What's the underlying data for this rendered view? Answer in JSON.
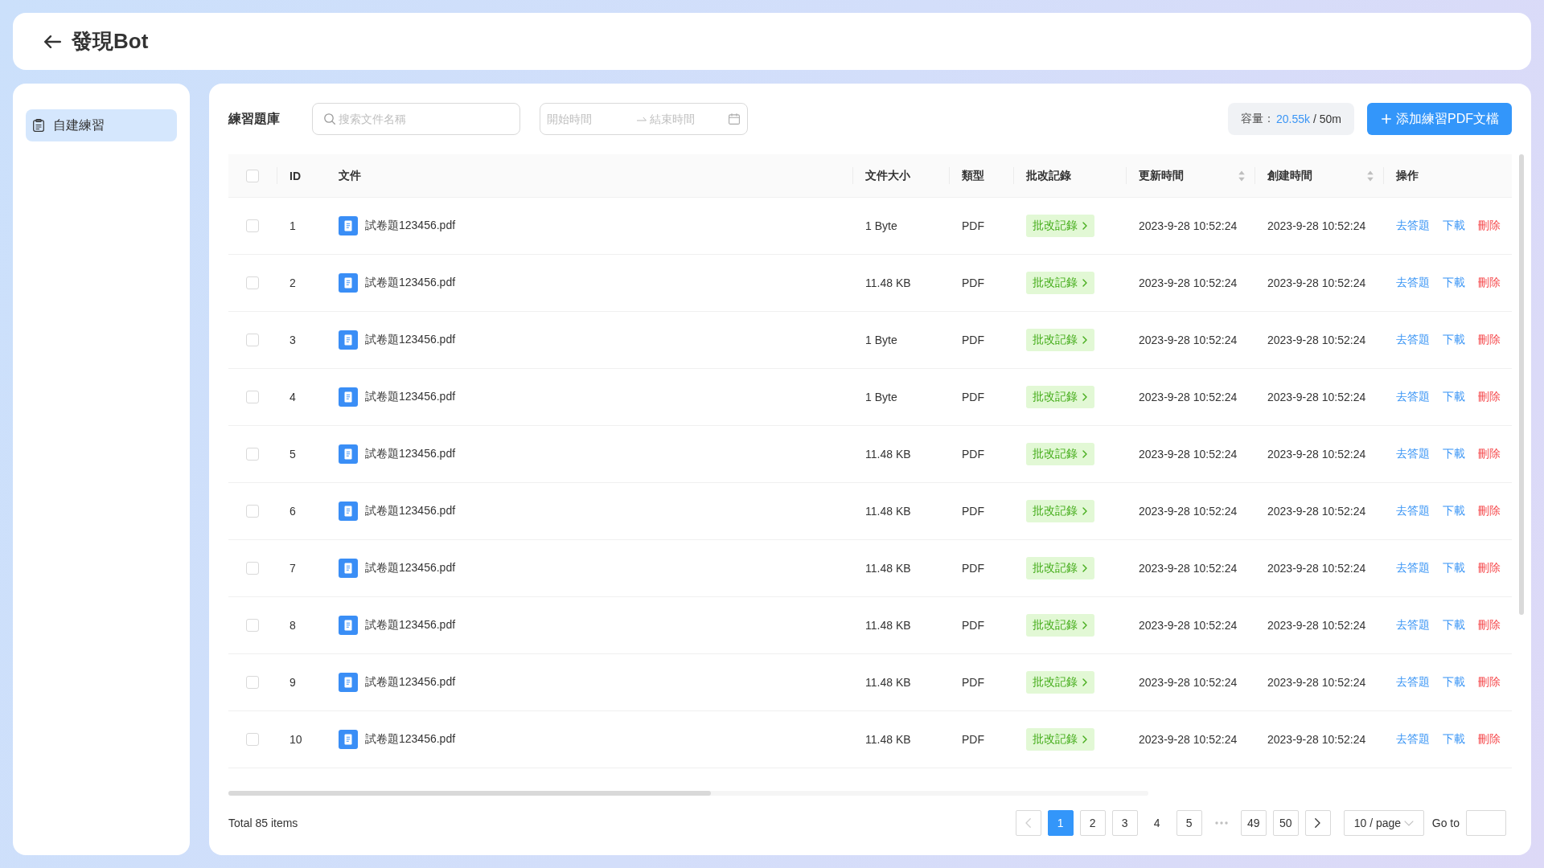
{
  "header": {
    "title": "發現Bot"
  },
  "sidebar": {
    "items": [
      {
        "label": "自建練習",
        "selected": true
      }
    ]
  },
  "toolbar": {
    "title": "練習題庫",
    "search": {
      "placeholder": "搜索文件名稱"
    },
    "date_range": {
      "start_placeholder": "開始時間",
      "end_placeholder": "結束時間"
    },
    "capacity": {
      "label": "容量：",
      "used": "20.55k",
      "total": "/ 50m"
    },
    "add_button": {
      "label": "添加練習PDF文檔"
    }
  },
  "table": {
    "select_all_checked": false,
    "columns": [
      {
        "label": "ID",
        "sortable": false
      },
      {
        "label": "文件",
        "sortable": false
      },
      {
        "label": "文件大小",
        "sortable": false
      },
      {
        "label": "類型",
        "sortable": false
      },
      {
        "label": "批改記錄",
        "sortable": false
      },
      {
        "label": "更新時間",
        "sortable": true
      },
      {
        "label": "創建時間",
        "sortable": true
      },
      {
        "label": "操作",
        "sortable": false
      }
    ],
    "rows": [
      {
        "checked": false,
        "id": "1",
        "file": "試卷題123456.pdf",
        "size": "1 Byte",
        "type": "PDF",
        "review": "批改記錄",
        "updated": "2023-9-28 10:52:24",
        "created": "2023-9-28 10:52:24",
        "actions": [
          {
            "label": "去答題",
            "kind": "primary"
          },
          {
            "label": "下載",
            "kind": "primary"
          },
          {
            "label": "刪除",
            "kind": "danger"
          }
        ]
      },
      {
        "checked": false,
        "id": "2",
        "file": "試卷題123456.pdf",
        "size": "11.48 KB",
        "type": "PDF",
        "review": "批改記錄",
        "updated": "2023-9-28 10:52:24",
        "created": "2023-9-28 10:52:24",
        "actions": [
          {
            "label": "去答題",
            "kind": "primary"
          },
          {
            "label": "下載",
            "kind": "primary"
          },
          {
            "label": "刪除",
            "kind": "danger"
          }
        ]
      },
      {
        "checked": false,
        "id": "3",
        "file": "試卷題123456.pdf",
        "size": "1 Byte",
        "type": "PDF",
        "review": "批改記錄",
        "updated": "2023-9-28 10:52:24",
        "created": "2023-9-28 10:52:24",
        "actions": [
          {
            "label": "去答題",
            "kind": "primary"
          },
          {
            "label": "下載",
            "kind": "primary"
          },
          {
            "label": "刪除",
            "kind": "danger"
          }
        ]
      },
      {
        "checked": false,
        "id": "4",
        "file": "試卷題123456.pdf",
        "size": "1 Byte",
        "type": "PDF",
        "review": "批改記錄",
        "updated": "2023-9-28 10:52:24",
        "created": "2023-9-28 10:52:24",
        "actions": [
          {
            "label": "去答題",
            "kind": "primary"
          },
          {
            "label": "下載",
            "kind": "primary"
          },
          {
            "label": "刪除",
            "kind": "danger"
          }
        ]
      },
      {
        "checked": false,
        "id": "5",
        "file": "試卷題123456.pdf",
        "size": "11.48 KB",
        "type": "PDF",
        "review": "批改記錄",
        "updated": "2023-9-28 10:52:24",
        "created": "2023-9-28 10:52:24",
        "actions": [
          {
            "label": "去答題",
            "kind": "primary"
          },
          {
            "label": "下載",
            "kind": "primary"
          },
          {
            "label": "刪除",
            "kind": "danger"
          }
        ]
      },
      {
        "checked": false,
        "id": "6",
        "file": "試卷題123456.pdf",
        "size": "11.48 KB",
        "type": "PDF",
        "review": "批改記錄",
        "updated": "2023-9-28 10:52:24",
        "created": "2023-9-28 10:52:24",
        "actions": [
          {
            "label": "去答題",
            "kind": "primary"
          },
          {
            "label": "下載",
            "kind": "primary"
          },
          {
            "label": "刪除",
            "kind": "danger"
          }
        ]
      },
      {
        "checked": false,
        "id": "7",
        "file": "試卷題123456.pdf",
        "size": "11.48 KB",
        "type": "PDF",
        "review": "批改記錄",
        "updated": "2023-9-28 10:52:24",
        "created": "2023-9-28 10:52:24",
        "actions": [
          {
            "label": "去答題",
            "kind": "primary"
          },
          {
            "label": "下載",
            "kind": "primary"
          },
          {
            "label": "刪除",
            "kind": "danger"
          }
        ]
      },
      {
        "checked": false,
        "id": "8",
        "file": "試卷題123456.pdf",
        "size": "11.48 KB",
        "type": "PDF",
        "review": "批改記錄",
        "updated": "2023-9-28 10:52:24",
        "created": "2023-9-28 10:52:24",
        "actions": [
          {
            "label": "去答題",
            "kind": "primary"
          },
          {
            "label": "下載",
            "kind": "primary"
          },
          {
            "label": "刪除",
            "kind": "danger"
          }
        ]
      },
      {
        "checked": false,
        "id": "9",
        "file": "試卷題123456.pdf",
        "size": "11.48 KB",
        "type": "PDF",
        "review": "批改記錄",
        "updated": "2023-9-28 10:52:24",
        "created": "2023-9-28 10:52:24",
        "actions": [
          {
            "label": "去答題",
            "kind": "primary"
          },
          {
            "label": "下載",
            "kind": "primary"
          },
          {
            "label": "刪除",
            "kind": "danger"
          }
        ]
      },
      {
        "checked": false,
        "id": "10",
        "file": "試卷題123456.pdf",
        "size": "11.48 KB",
        "type": "PDF",
        "review": "批改記錄",
        "updated": "2023-9-28 10:52:24",
        "created": "2023-9-28 10:52:24",
        "actions": [
          {
            "label": "去答題",
            "kind": "primary"
          },
          {
            "label": "下載",
            "kind": "primary"
          },
          {
            "label": "刪除",
            "kind": "danger"
          }
        ]
      }
    ]
  },
  "footer": {
    "total": "Total 85 items",
    "pagination": {
      "prev": {
        "disabled": true
      },
      "pages": [
        {
          "label": "1",
          "selected": true,
          "outlined": true
        },
        {
          "label": "2",
          "selected": false,
          "outlined": true
        },
        {
          "label": "3",
          "selected": false,
          "outlined": true
        },
        {
          "label": "4",
          "selected": false,
          "outlined": false
        },
        {
          "label": "5",
          "selected": false,
          "outlined": true
        }
      ],
      "ellipsis": true,
      "end_pages": [
        {
          "label": "49",
          "selected": false,
          "outlined": true
        },
        {
          "label": "50",
          "selected": false,
          "outlined": true
        }
      ],
      "next": {
        "disabled": false
      },
      "page_size": "10 / page",
      "go_to": {
        "label": "Go to"
      }
    }
  }
}
